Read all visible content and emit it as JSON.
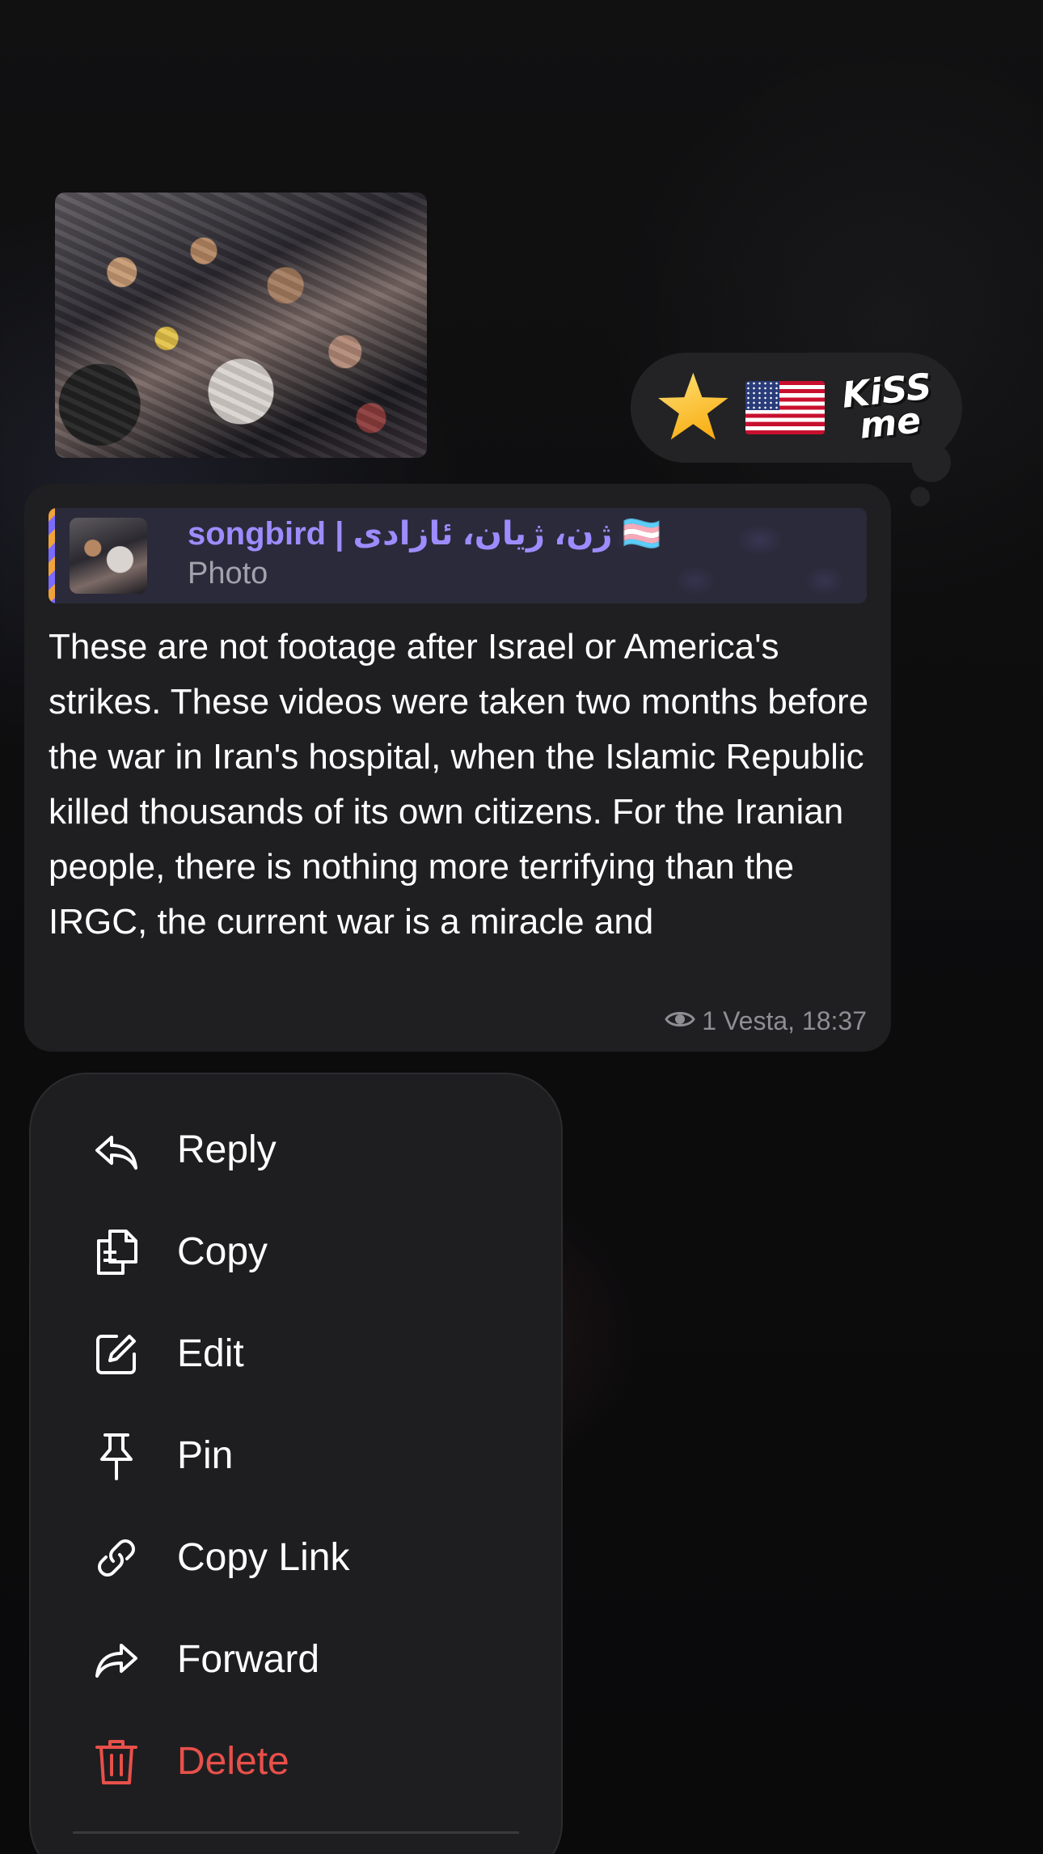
{
  "reactions": {
    "items": [
      {
        "name": "star-emoji"
      },
      {
        "name": "us-flag-emoji"
      },
      {
        "name": "kiss-me-sticker",
        "text": "KiSS me"
      }
    ]
  },
  "message": {
    "reply": {
      "author": "songbird | ژن، ژیان، ئازادی 🏳️‍⚧️",
      "type": "Photo"
    },
    "text": "These are not footage after Israel or America's strikes. These videos were taken two months before the war in Iran's hospital, when the Islamic Republic killed thousands of its own citizens. For the Iranian people, there is nothing more terrifying than the IRGC, the current war is a miracle and",
    "views": "1",
    "date_time": "Vesta, 18:37"
  },
  "menu": {
    "items": [
      {
        "label": "Reply",
        "icon": "reply-icon"
      },
      {
        "label": "Copy",
        "icon": "copy-icon"
      },
      {
        "label": "Edit",
        "icon": "edit-icon"
      },
      {
        "label": "Pin",
        "icon": "pin-icon"
      },
      {
        "label": "Copy Link",
        "icon": "link-icon"
      },
      {
        "label": "Forward",
        "icon": "forward-icon"
      },
      {
        "label": "Delete",
        "icon": "trash-icon"
      }
    ]
  },
  "colors": {
    "accent_name": "#9d8cff",
    "danger": "#e8504a",
    "bubble_bg": "#1f1f21",
    "menu_bg": "#1e1e20"
  }
}
